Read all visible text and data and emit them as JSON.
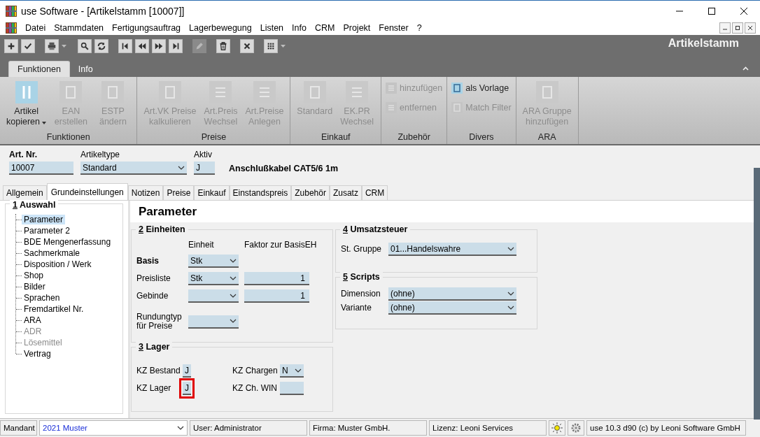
{
  "window": {
    "title": "use Software - [Artikelstamm [10007]]"
  },
  "menu": [
    "Datei",
    "Stammdaten",
    "Fertigungsauftrag",
    "Lagerbewegung",
    "Listen",
    "Info",
    "CRM",
    "Projekt",
    "Fenster",
    "?"
  ],
  "toolbar": {
    "buttons": [
      {
        "disabled": false,
        "menu": false
      },
      {
        "disabled": false,
        "menu": false
      },
      {
        "disabled": false,
        "menu": true
      },
      {
        "disabled": false,
        "menu": false
      },
      {
        "disabled": false,
        "menu": false
      },
      {
        "disabled": false,
        "menu": false
      },
      {
        "disabled": false,
        "menu": false
      },
      {
        "disabled": false,
        "menu": false
      },
      {
        "disabled": false,
        "menu": false
      },
      {
        "disabled": true,
        "menu": false
      },
      {
        "disabled": false,
        "menu": false
      },
      {
        "disabled": false,
        "menu": false
      },
      {
        "disabled": false,
        "menu": true
      }
    ],
    "module_title": "Artikelstamm"
  },
  "ribbon": {
    "tabs": [
      {
        "label": "Funktionen",
        "selected": true
      },
      {
        "label": "Info",
        "selected": false
      }
    ],
    "groups": [
      {
        "title": "Funktionen",
        "items": [
          {
            "kind": "large",
            "label": "Artikel\nkopieren",
            "disabled": false,
            "dropdown": true
          },
          {
            "kind": "large",
            "label": "EAN\nerstellen",
            "disabled": true,
            "dropdown": false
          },
          {
            "kind": "large",
            "label": "ESTP\nändern",
            "disabled": true,
            "dropdown": false
          }
        ]
      },
      {
        "title": "Preise",
        "items": [
          {
            "kind": "large",
            "label": "Art.VK Preise\nkalkulieren",
            "disabled": true,
            "dropdown": false
          },
          {
            "kind": "large",
            "label": "Art.Preis\nWechsel",
            "disabled": true,
            "dropdown": false
          },
          {
            "kind": "large",
            "label": "Art.Preise\nAnlegen",
            "disabled": true,
            "dropdown": false
          }
        ]
      },
      {
        "title": "Einkauf",
        "items": [
          {
            "kind": "large",
            "label": "Standard",
            "disabled": true,
            "dropdown": false
          },
          {
            "kind": "large",
            "label": "EK.PR\nWechsel",
            "disabled": true,
            "dropdown": false
          }
        ]
      },
      {
        "title": "Zubehör",
        "items": [
          {
            "kind": "small",
            "label": "hinzufügen",
            "disabled": true
          },
          {
            "kind": "small",
            "label": "entfernen",
            "disabled": true
          }
        ]
      },
      {
        "title": "Divers",
        "items": [
          {
            "kind": "toggle",
            "label": "als Vorlage",
            "disabled": false,
            "selected": true
          },
          {
            "kind": "toggle",
            "label": "Match Filter",
            "disabled": true,
            "selected": false
          }
        ]
      },
      {
        "title": "ARA",
        "items": [
          {
            "kind": "large",
            "label": "ARA Gruppe\nhinzufügen",
            "disabled": true,
            "dropdown": false
          }
        ]
      }
    ]
  },
  "article": {
    "number": {
      "label": "Art. Nr.",
      "value": "10007"
    },
    "type": {
      "label": "Artikeltype",
      "value": "Standard"
    },
    "active": {
      "label": "Aktiv",
      "value": "J"
    },
    "description": "Anschlußkabel CAT5/6 1m"
  },
  "tabs": [
    {
      "label": "Allgemein",
      "selected": false
    },
    {
      "label": "Grundeinstellungen",
      "selected": true
    },
    {
      "label": "Notizen",
      "selected": false
    },
    {
      "label": "Preise",
      "selected": false
    },
    {
      "label": "Einkauf",
      "selected": false
    },
    {
      "label": "Einstandspreis",
      "selected": false
    },
    {
      "label": "Zubehör",
      "selected": false
    },
    {
      "label": "Zusatz",
      "selected": false
    },
    {
      "label": "CRM",
      "selected": false
    }
  ],
  "tree": {
    "number": "1",
    "title": "Auswahl",
    "items": [
      {
        "label": "Parameter",
        "selected": true,
        "disabled": false
      },
      {
        "label": "Parameter 2",
        "selected": false,
        "disabled": false
      },
      {
        "label": "BDE Mengenerfassung",
        "selected": false,
        "disabled": false
      },
      {
        "label": "Sachmerkmale",
        "selected": false,
        "disabled": false
      },
      {
        "label": "Disposition / Werk",
        "selected": false,
        "disabled": false
      },
      {
        "label": "Shop",
        "selected": false,
        "disabled": false
      },
      {
        "label": "Bilder",
        "selected": false,
        "disabled": false
      },
      {
        "label": "Sprachen",
        "selected": false,
        "disabled": false
      },
      {
        "label": "Fremdartikel Nr.",
        "selected": false,
        "disabled": false
      },
      {
        "label": "ARA",
        "selected": false,
        "disabled": false
      },
      {
        "label": "ADR",
        "selected": false,
        "disabled": true
      },
      {
        "label": "Lösemittel",
        "selected": false,
        "disabled": true
      },
      {
        "label": "Vertrag",
        "selected": false,
        "disabled": false
      }
    ]
  },
  "page_title": "Parameter",
  "units": {
    "number": "2",
    "title": "Einheiten",
    "columns": [
      "Einheit",
      "Faktor zur BasisEH"
    ],
    "rows": [
      {
        "label": "Basis",
        "bold": true,
        "unit": "Stk"
      },
      {
        "label": "Preisliste",
        "bold": false,
        "unit": "Stk",
        "factor": "1"
      },
      {
        "label": "Gebinde",
        "bold": false,
        "factor": "1"
      },
      {
        "label": "Rundungtyp\nfür Preise",
        "bold": false
      }
    ]
  },
  "stock": {
    "number": "3",
    "title": "Lager",
    "fields": [
      {
        "label": "KZ Bestand",
        "kind": "text",
        "value": "J",
        "highlighted": false
      },
      {
        "label": "KZ Chargen",
        "kind": "select",
        "value": "N",
        "highlighted": false
      },
      {
        "label": "KZ Lager",
        "kind": "text",
        "value": "J",
        "highlighted": true
      },
      {
        "label": "KZ Ch. WIN",
        "kind": "text",
        "highlighted": false
      }
    ]
  },
  "tax": {
    "number": "4",
    "title": "Umsatzsteuer",
    "fields": [
      {
        "label": "St. Gruppe",
        "value": "01...Handelswahre"
      }
    ]
  },
  "scripts": {
    "number": "5",
    "title": "Scripts",
    "fields": [
      {
        "label": "Dimension",
        "value": "(ohne)"
      },
      {
        "label": "Variante",
        "value": "(ohne)"
      }
    ]
  },
  "status_bar": {
    "mandant_label": "Mandant",
    "mandant": "2021 Muster",
    "user": "User: Administrator",
    "firma": "Firma: Muster GmbH.",
    "lizenz": "Lizenz: Leoni Services",
    "version": "use 10.3 d90 (c) by Leoni Software GmbH"
  }
}
